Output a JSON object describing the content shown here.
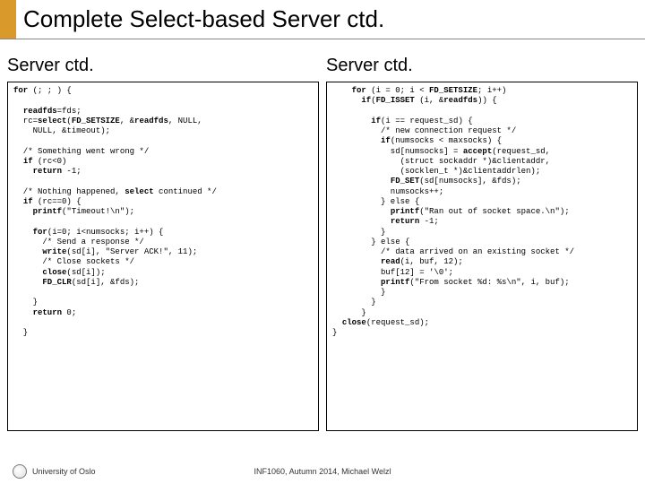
{
  "title": "Complete Select-based Server ctd.",
  "left": {
    "heading": "Server ctd.",
    "code": "for (; ; ) {\n\n  readfds=fds;\n  rc=select(FD_SETSIZE, &readfds, NULL,\n    NULL, &timeout);\n\n  /* Something went wrong */\n  if (rc<0)\n    return -1;\n\n  /* Nothing happened, select continued */\n  if (rc==0) {\n    printf(\"Timeout!\\n\");\n\n    for(i=0; i<numsocks; i++) {\n      /* Send a response */\n      write(sd[i], \"Server ACK!\", 11);\n      /* Close sockets */\n      close(sd[i]);\n      FD_CLR(sd[i], &fds);\n\n    }\n    return 0;\n\n  }"
  },
  "right": {
    "heading": "Server ctd.",
    "code": "    for (i = 0; i < FD_SETSIZE; i++)\n      if(FD_ISSET (i, &readfds)) {\n\n        if(i == request_sd) {\n          /* new connection request */\n          if(numsocks < maxsocks) {\n            sd[numsocks] = accept(request_sd,\n              (struct sockaddr *)&clientaddr,\n              (socklen_t *)&clientaddrlen);\n            FD_SET(sd[numsocks], &fds);\n            numsocks++;\n          } else {\n            printf(\"Ran out of socket space.\\n\");\n            return -1;\n          }\n        } else {\n          /* data arrived on an existing socket */\n          read(i, buf, 12);\n          buf[12] = '\\0';\n          printf(\"From socket %d: %s\\n\", i, buf);\n          }\n        }\n      }\n  close(request_sd);\n}"
  },
  "footer": {
    "institution": "University of Oslo",
    "attribution": "INF1060, Autumn 2014, Michael Welzl"
  }
}
